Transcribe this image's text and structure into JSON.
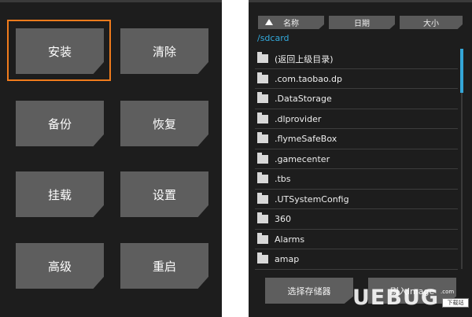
{
  "main_menu": {
    "buttons": [
      "安装",
      "清除",
      "备份",
      "恢复",
      "挂载",
      "设置",
      "高级",
      "重启"
    ],
    "selected": "安装",
    "accent_color": "#ef7b1c"
  },
  "file_browser": {
    "sort": {
      "name": "名称",
      "date": "日期",
      "size": "大小"
    },
    "path": "/sdcard",
    "items": [
      "(返回上级目录)",
      ".com.taobao.dp",
      ".DataStorage",
      ".dlprovider",
      ".flymeSafeBox",
      ".gamecenter",
      ".tbs",
      ".UTSystemConfig",
      "360",
      "Alarms",
      "amap"
    ],
    "storage_button": "选择存储器",
    "image_button": "刷入Image",
    "scroll_color": "#34a6d8"
  },
  "watermark": {
    "logo": "UEBUG",
    "sub": ".com",
    "badge": "下载站"
  }
}
